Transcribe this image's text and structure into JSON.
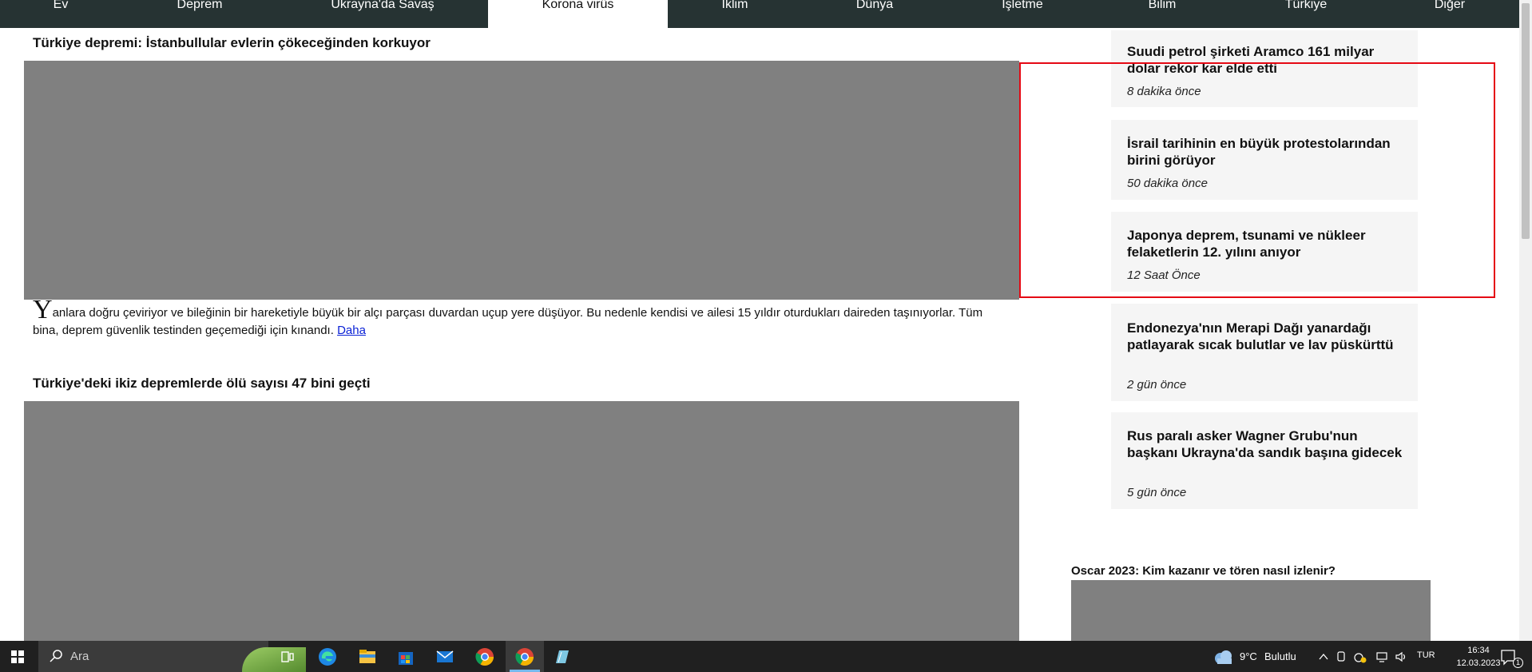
{
  "nav": {
    "items": [
      {
        "label": "Ev"
      },
      {
        "label": "Deprem"
      },
      {
        "label": "Ukrayna'da Savaş"
      },
      {
        "label": "Korona virüs"
      },
      {
        "label": "İklim"
      },
      {
        "label": "Dünya"
      },
      {
        "label": "İşletme"
      },
      {
        "label": "Bilim"
      },
      {
        "label": "Türkiye"
      },
      {
        "label": "Diğer"
      }
    ],
    "active": "Korona virüs"
  },
  "main": {
    "articles": [
      {
        "headline": "Türkiye depremi: İstanbullular evlerin çökeceğinden korkuyor",
        "dropcap": "Y",
        "body": "anlara doğru çeviriyor ve bileğinin bir hareketiyle büyük bir alçı parçası duvardan uçup yere düşüyor. Bu nedenle kendisi ve ailesi 15 yıldır oturdukları daireden taşınıyorlar. Tüm bina, deprem güvenlik testinden geçemediği için kınandı.",
        "more_label": "Daha"
      },
      {
        "headline": "Türkiye'deki ikiz depremlerde ölü sayısı 47 bini geçti"
      }
    ]
  },
  "sidebar": {
    "cards": [
      {
        "title": "Suudi petrol şirketi Aramco 161 milyar dolar rekor kar elde etti",
        "time": "8 dakika önce"
      },
      {
        "title": "İsrail tarihinin en büyük protestolarından birini görüyor",
        "time": "50 dakika önce"
      },
      {
        "title": "Japonya deprem, tsunami ve nükleer felaketlerin 12. yılını anıyor",
        "time": "12 Saat Önce"
      },
      {
        "title": "Endonezya'nın Merapi Dağı yanardağı patlayarak sıcak bulutlar ve lav püskürttü",
        "time": "2 gün önce"
      },
      {
        "title": "Rus paralı asker Wagner Grubu'nun başkanı Ukrayna'da sandık başına gidecek",
        "time": "5 gün önce"
      }
    ],
    "feature_headline": "Oscar 2023: Kim kazanır ve tören nasıl izlenir?"
  },
  "highlight": {
    "color": "#e50914"
  },
  "taskbar": {
    "search_placeholder": "Ara",
    "weather_temp": "9°C",
    "weather_desc": "Bulutlu",
    "language": "TUR",
    "time": "16:34",
    "date": "12.03.2023",
    "notification_count": "1",
    "apps": [
      "task-view-icon",
      "edge-icon",
      "file-explorer-icon",
      "store-icon",
      "mail-icon",
      "chrome-icon",
      "chrome-active-icon",
      "notepad-icon"
    ]
  },
  "colors": {
    "nav_bg": "#263333",
    "card_bg": "#f5f5f5",
    "media_placeholder": "#808080",
    "taskbar_bg": "#202020",
    "link": "#0b22d6"
  }
}
